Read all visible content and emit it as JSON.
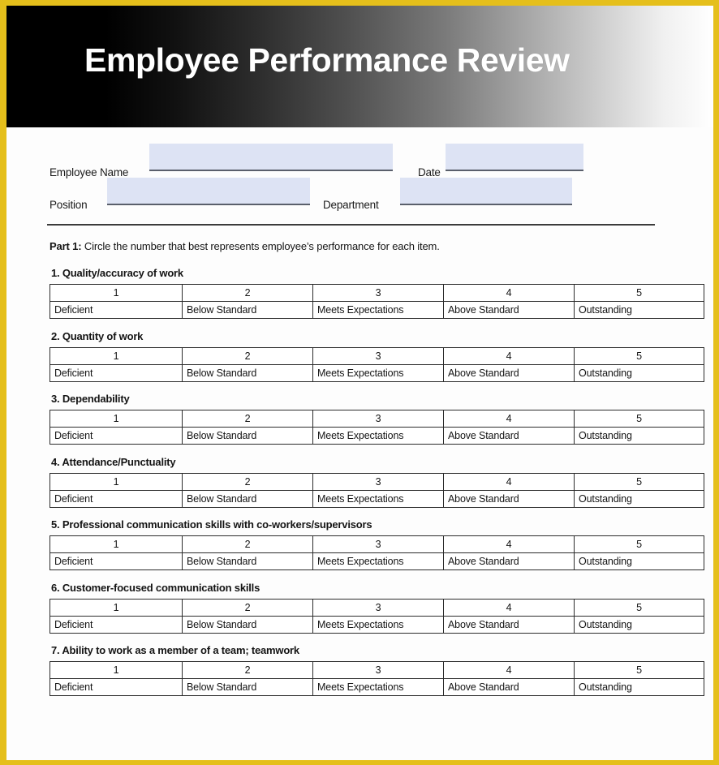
{
  "banner": {
    "title": "Employee Performance Review"
  },
  "form": {
    "employee_name": {
      "label": "Employee Name",
      "value": "",
      "placeholder": ""
    },
    "date": {
      "label": "Date",
      "value": "",
      "placeholder": ""
    },
    "position": {
      "label": "Position",
      "value": "",
      "placeholder": ""
    },
    "department": {
      "label": "Department",
      "value": "",
      "placeholder": ""
    }
  },
  "part1": {
    "lead": "Part 1:",
    "instruction": " Circle the number that best represents employee’s performance for each item."
  },
  "scale": {
    "scores": [
      "1",
      "2",
      "3",
      "4",
      "5"
    ],
    "labels": [
      "Deficient",
      "Below Standard",
      "Meets Expectations",
      "Above Standard",
      "Outstanding"
    ]
  },
  "items": [
    {
      "heading": "1. Quality/accuracy of work"
    },
    {
      "heading": "2. Quantity of work"
    },
    {
      "heading": "3. Dependability"
    },
    {
      "heading": "4. Attendance/Punctuality"
    },
    {
      "heading": "5. Professional communication skills with co-workers/supervisors"
    },
    {
      "heading": "6. Customer-focused communication skills"
    },
    {
      "heading": "7. Ability to work as a member of a team; teamwork"
    }
  ],
  "colors": {
    "page_border": "#e5bf1b",
    "banner_start": "#000000",
    "banner_end": "#ffffff",
    "input_fill": "#dde3f4",
    "table_border": "#2b2b2b",
    "text": "#151515"
  }
}
